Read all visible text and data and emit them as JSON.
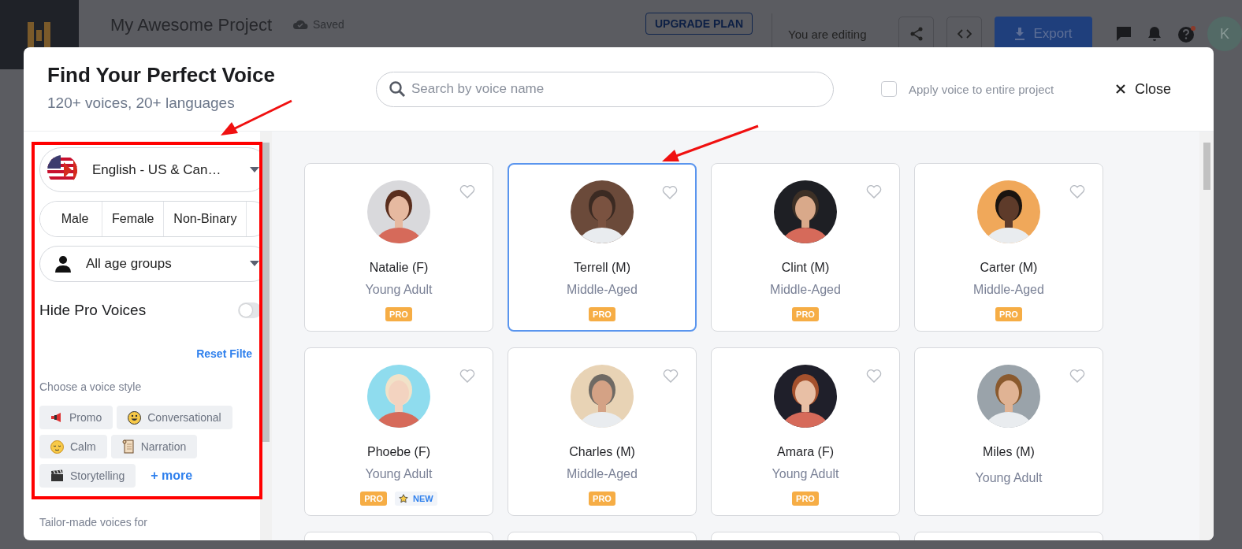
{
  "app_bar": {
    "project_title": "My Awesome Project",
    "save_status": "Saved",
    "upgrade_button": "UPGRADE PLAN",
    "editing_status": "You are editing",
    "export_button": "Export",
    "avatar_initial": "K"
  },
  "dialog": {
    "title": "Find Your Perfect Voice",
    "subtitle": "120+ voices, 20+ languages",
    "search": {
      "placeholder": "Search by voice name"
    },
    "apply_to_project": {
      "label": "Apply voice to entire project",
      "checked": false
    },
    "close_button": "Close"
  },
  "filters": {
    "language": {
      "value": "English - US & Can…"
    },
    "genders": [
      {
        "label": "Male",
        "selected": false
      },
      {
        "label": "Female",
        "selected": false
      },
      {
        "label": "Non-Binary",
        "selected": false
      }
    ],
    "age_group": {
      "value": "All age groups"
    },
    "hide_pro": {
      "label": "Hide Pro Voices",
      "on": false
    },
    "reset_link": "Reset Filte",
    "style_heading": "Choose a voice style",
    "styles": [
      {
        "kind": "promo",
        "label": "Promo"
      },
      {
        "kind": "conversational",
        "label": "Conversational"
      },
      {
        "kind": "calm",
        "label": "Calm"
      },
      {
        "kind": "narration",
        "label": "Narration"
      },
      {
        "kind": "storytelling",
        "label": "Storytelling"
      }
    ],
    "more_link": "+ more",
    "tailor_heading": "Tailor-made voices for"
  },
  "voices": [
    {
      "name": "Natalie (F)",
      "age": "Young Adult",
      "selected": false,
      "badges": [
        {
          "kind": "pro",
          "label": "PRO"
        }
      ]
    },
    {
      "name": "Terrell (M)",
      "age": "Middle-Aged",
      "selected": true,
      "badges": [
        {
          "kind": "pro",
          "label": "PRO"
        }
      ]
    },
    {
      "name": "Clint (M)",
      "age": "Middle-Aged",
      "selected": false,
      "badges": [
        {
          "kind": "pro",
          "label": "PRO"
        }
      ]
    },
    {
      "name": "Carter (M)",
      "age": "Middle-Aged",
      "selected": false,
      "badges": [
        {
          "kind": "pro",
          "label": "PRO"
        }
      ]
    },
    {
      "name": "Phoebe (F)",
      "age": "Young Adult",
      "selected": false,
      "badges": [
        {
          "kind": "pro",
          "label": "PRO"
        },
        {
          "kind": "new",
          "label": "NEW"
        }
      ]
    },
    {
      "name": "Charles (M)",
      "age": "Middle-Aged",
      "selected": false,
      "badges": [
        {
          "kind": "pro",
          "label": "PRO"
        }
      ]
    },
    {
      "name": "Amara (F)",
      "age": "Young Adult",
      "selected": false,
      "badges": [
        {
          "kind": "pro",
          "label": "PRO"
        }
      ]
    },
    {
      "name": "Miles (M)",
      "age": "Young Adult",
      "selected": false
    }
  ]
}
